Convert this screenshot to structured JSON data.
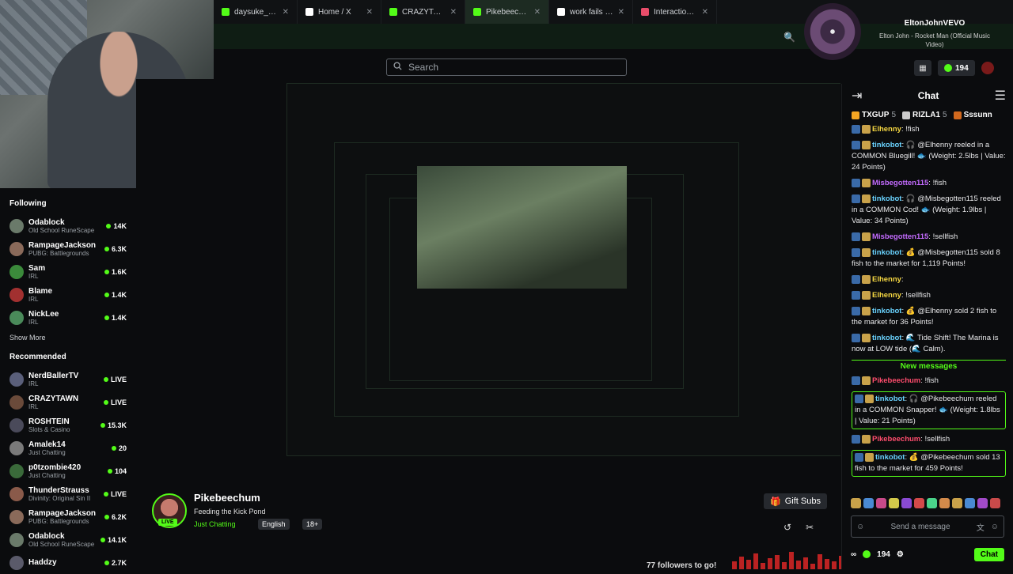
{
  "tabs": [
    {
      "title": "daysuke_uwu Stre",
      "color": "#53fc18",
      "active": false
    },
    {
      "title": "Home / X",
      "color": "#ffffff",
      "active": false
    },
    {
      "title": "CRAZYTAWN",
      "color": "#53fc18",
      "active": false
    },
    {
      "title": "Pikebeechum",
      "color": "#53fc18",
      "active": true
    },
    {
      "title": "work fails - Searc",
      "color": "#ffffff",
      "active": false
    },
    {
      "title": "Interaction | BotR",
      "color": "#e84d6a",
      "active": false
    }
  ],
  "search": {
    "placeholder": "Search"
  },
  "following": {
    "title": "Following",
    "items": [
      {
        "name": "Odablock",
        "category": "Old School RuneScape",
        "viewers": "14K",
        "avatar_color": "#6a7a6a"
      },
      {
        "name": "RampageJackson",
        "category": "PUBG: Battlegrounds",
        "viewers": "6.3K",
        "avatar_color": "#8a6a5a"
      },
      {
        "name": "Sam",
        "category": "IRL",
        "viewers": "1.6K",
        "avatar_color": "#3b8a3b"
      },
      {
        "name": "Blame",
        "category": "IRL",
        "viewers": "1.4K",
        "avatar_color": "#a23030"
      },
      {
        "name": "NickLee",
        "category": "IRL",
        "viewers": "1.4K",
        "avatar_color": "#4a8a5a"
      }
    ],
    "show_more": "Show More"
  },
  "recommended": {
    "title": "Recommended",
    "items": [
      {
        "name": "NerdBallerTV",
        "category": "IRL",
        "viewers": "LIVE",
        "avatar_color": "#5a5f7a"
      },
      {
        "name": "CRAZYTAWN",
        "category": "IRL",
        "viewers": "LIVE",
        "avatar_color": "#6a4a3a"
      },
      {
        "name": "ROSHTEIN",
        "category": "Slots & Casino",
        "viewers": "15.3K",
        "avatar_color": "#4a4a5a"
      },
      {
        "name": "Amalek14",
        "category": "Just Chatting",
        "viewers": "20",
        "avatar_color": "#7a7a7a"
      },
      {
        "name": "p0tzombie420",
        "category": "Just Chatting",
        "viewers": "104",
        "avatar_color": "#3a6a3a"
      },
      {
        "name": "ThunderStrauss",
        "category": "Divinity: Original Sin II",
        "viewers": "LIVE",
        "avatar_color": "#8a5a4a"
      },
      {
        "name": "RampageJackson",
        "category": "PUBG: Battlegrounds",
        "viewers": "6.2K",
        "avatar_color": "#8a6a5a"
      },
      {
        "name": "Odablock",
        "category": "Old School RuneScape",
        "viewers": "14.1K",
        "avatar_color": "#6a7a6a"
      },
      {
        "name": "Haddzy",
        "category": "",
        "viewers": "2.7K",
        "avatar_color": "#5a5a6a"
      }
    ]
  },
  "streamer": {
    "name": "Pikebeechum",
    "title": "Feeding the Kick Pond",
    "category": "Just Chatting",
    "tags": [
      "English",
      "18+"
    ],
    "live": "LIVE",
    "followers": "77 followers to go!"
  },
  "gift_subs": "Gift Subs",
  "now_playing": {
    "artist": "EltonJohnVEVO",
    "track": "Elton John - Rocket Man (Official Music Video)"
  },
  "kicks_count": "194",
  "chat": {
    "title": "Chat",
    "gifters": [
      {
        "name": "TXGUP",
        "count": "5",
        "color": "#f5a623"
      },
      {
        "name": "RIZLA1",
        "count": "5",
        "color": "#cccccc"
      },
      {
        "name": "Sssunn",
        "count": "",
        "color": "#d2691e"
      }
    ],
    "messages": [
      {
        "user": "Elhenny",
        "color": "#f5d742",
        "text": "!fish",
        "highlight": false
      },
      {
        "user": "tinkobot",
        "color": "#6ad3ff",
        "text": "🎧 @Elhenny reeled in a COMMON Bluegill! 🐟 (Weight: 2.5lbs | Value: 24 Points)",
        "highlight": false
      },
      {
        "user": "Misbegotten115",
        "color": "#c46bff",
        "text": "!fish",
        "highlight": false
      },
      {
        "user": "tinkobot",
        "color": "#6ad3ff",
        "text": "🎧 @Misbegotten115 reeled in a COMMON Cod! 🐟 (Weight: 1.9lbs | Value: 34 Points)",
        "highlight": false
      },
      {
        "user": "Misbegotten115",
        "color": "#c46bff",
        "text": "!sellfish",
        "highlight": false
      },
      {
        "user": "tinkobot",
        "color": "#6ad3ff",
        "text": "💰 @Misbegotten115 sold 8 fish to the market for 1,119 Points!",
        "highlight": false
      },
      {
        "user": "Elhenny",
        "color": "#f5d742",
        "text": "",
        "highlight": false
      },
      {
        "user": "Elhenny",
        "color": "#f5d742",
        "text": "!sellfish",
        "highlight": false
      },
      {
        "user": "tinkobot",
        "color": "#6ad3ff",
        "text": "💰 @Elhenny sold 2 fish to the market for 36 Points!",
        "highlight": false
      },
      {
        "user": "tinkobot",
        "color": "#6ad3ff",
        "text": "🌊 Tide Shift! The Marina is now at LOW tide (🌊 Calm).",
        "highlight": false
      }
    ],
    "new_messages": "New messages",
    "new": [
      {
        "user": "Pikebeechum",
        "color": "#ff4d6d",
        "text": "!fish",
        "highlight": false
      },
      {
        "user": "tinkobot",
        "color": "#6ad3ff",
        "text": "🎧 @Pikebeechum reeled in a COMMON Snapper! 🐟 (Weight: 1.8lbs | Value: 21 Points)",
        "highlight": true
      },
      {
        "user": "Pikebeechum",
        "color": "#ff4d6d",
        "text": "!sellfish",
        "highlight": false
      },
      {
        "user": "tinkobot",
        "color": "#6ad3ff",
        "text": "💰 @Pikebeechum sold 13 fish to the market for 459 Points!",
        "highlight": true
      }
    ],
    "send_placeholder": "Send a message",
    "points": "194",
    "chat_button": "Chat"
  }
}
